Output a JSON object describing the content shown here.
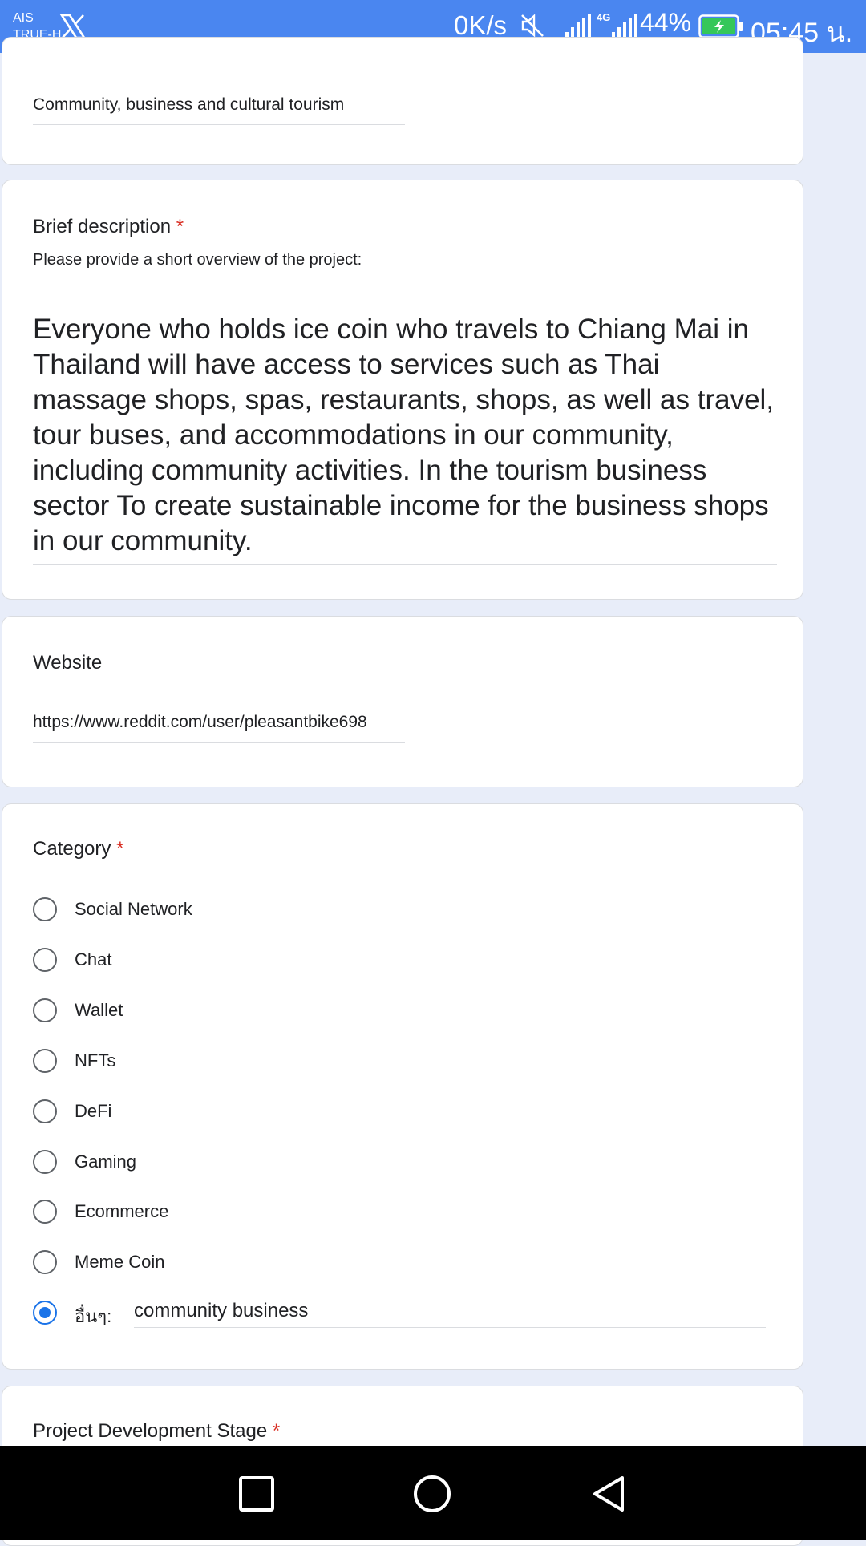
{
  "status_bar": {
    "carrier_line1": "AIS",
    "carrier_line2": "TRUE-H",
    "app_icon": "x-logo-icon",
    "net_speed": "0K/s",
    "network_type": "4G",
    "battery": "44%",
    "clock": "05:45 น."
  },
  "prev_answer": {
    "value": "Community, business and cultural tourism"
  },
  "brief_description": {
    "title": "Brief description",
    "required_mark": "*",
    "help": "Please provide a short overview of the project:",
    "value": "Everyone who holds ice coin who travels to Chiang Mai in Thailand will have access to services such as Thai massage shops, spas, restaurants, shops, as well as travel, tour buses, and accommodations in our community, including community activities.  In the tourism business sector  To create sustainable income for the business shops in our community."
  },
  "website": {
    "title": "Website",
    "value": "https://www.reddit.com/user/pleasantbike698"
  },
  "category": {
    "title": "Category",
    "required_mark": "*",
    "options": [
      {
        "label": "Social Network",
        "checked": false
      },
      {
        "label": "Chat",
        "checked": false
      },
      {
        "label": "Wallet",
        "checked": false
      },
      {
        "label": "NFTs",
        "checked": false
      },
      {
        "label": "DeFi",
        "checked": false
      },
      {
        "label": "Gaming",
        "checked": false
      },
      {
        "label": "Ecommerce",
        "checked": false
      },
      {
        "label": "Meme Coin",
        "checked": false
      }
    ],
    "other_label": "อื่นๆ:",
    "other_checked": true,
    "other_value": "community business"
  },
  "project_stage": {
    "title": "Project Development Stage",
    "required_mark": "*"
  },
  "colors": {
    "status_bar": "#4a86f0",
    "page_background": "#e8edf9",
    "required": "#d93025",
    "radio_selected": "#1a73e8"
  }
}
